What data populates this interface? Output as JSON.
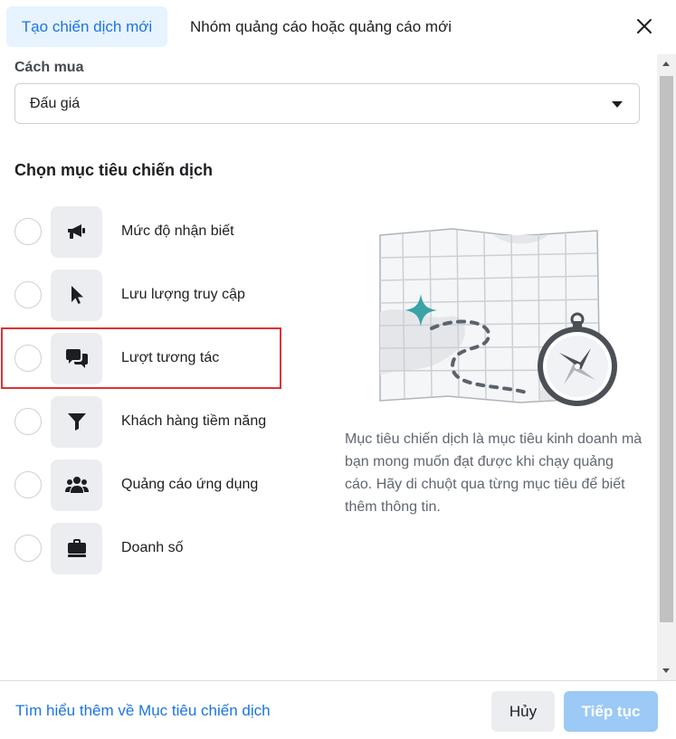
{
  "header": {
    "tab_active": "Tạo chiến dịch mới",
    "tab_other": "Nhóm quảng cáo hoặc quảng cáo mới",
    "close_icon": "close-icon"
  },
  "buying_type": {
    "label": "Cách mua",
    "value": "Đấu giá",
    "caret_icon": "caret-down-icon"
  },
  "objectives": {
    "title": "Chọn mục tiêu chiến dịch",
    "items": [
      {
        "label": "Mức độ nhận biết",
        "icon": "megaphone-icon"
      },
      {
        "label": "Lưu lượng truy cập",
        "icon": "cursor-icon"
      },
      {
        "label": "Lượt tương tác",
        "icon": "chat-bubbles-icon"
      },
      {
        "label": "Khách hàng tiềm năng",
        "icon": "funnel-icon"
      },
      {
        "label": "Quảng cáo ứng dụng",
        "icon": "people-icon"
      },
      {
        "label": "Doanh số",
        "icon": "briefcase-icon"
      }
    ],
    "highlighted_index": 2
  },
  "info": {
    "description": "Mục tiêu chiến dịch là mục tiêu kinh doanh mà bạn mong muốn đạt được khi chạy quảng cáo. Hãy di chuột qua từng mục tiêu để biết thêm thông tin.",
    "illustration": "map-compass-illustration"
  },
  "footer": {
    "learn_more": "Tìm hiểu thêm về Mục tiêu chiến dịch",
    "cancel": "Hủy",
    "next": "Tiếp tục"
  },
  "colors": {
    "accent": "#1b74e4",
    "tab_active_bg": "#e7f3ff",
    "highlight_border": "#dd3333",
    "next_disabled": "#9cc9f5",
    "illustration_teal": "#3aa3a6"
  }
}
